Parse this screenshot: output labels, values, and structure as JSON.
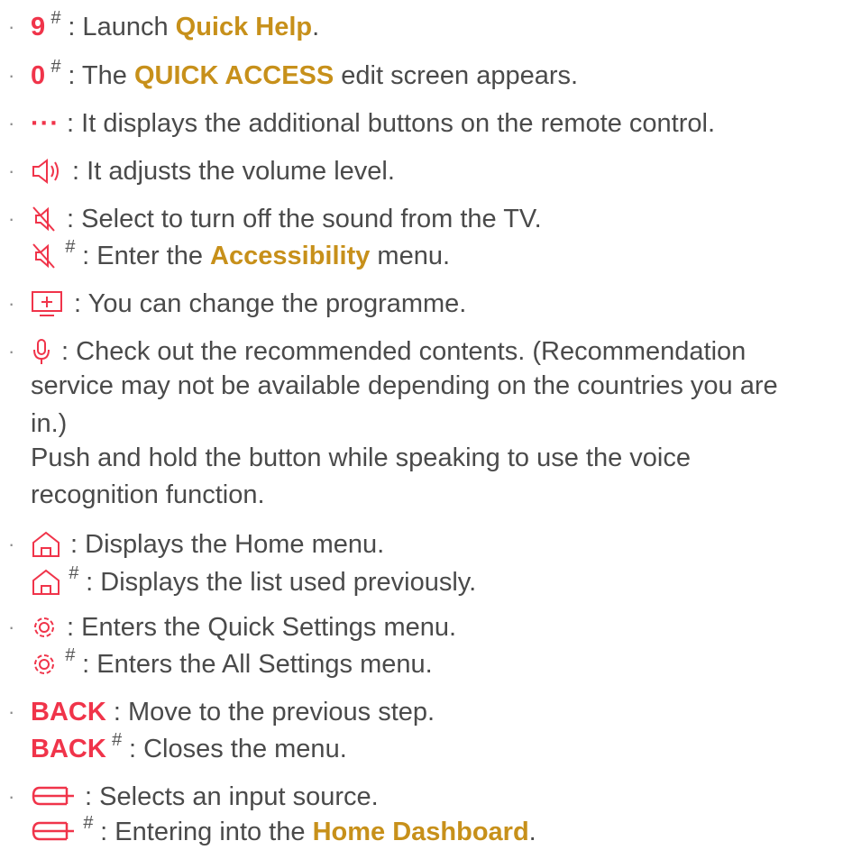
{
  "items": [
    {
      "key": "9",
      "text_pre": " : Launch ",
      "emph": "Quick Help",
      "text_post": "."
    },
    {
      "key": "0",
      "text_pre": " : The ",
      "emph": "QUICK ACCESS",
      "text_post": " edit screen appears."
    },
    {
      "key": "···",
      "text": " : It displays the additional buttons on the remote control."
    },
    {
      "text": " : It adjusts the volume level.",
      "icon": "volume-icon"
    },
    {
      "text": " : Select to turn off the sound from the TV.",
      "icon": "mute-icon"
    },
    {
      "text_pre": " : Enter the ",
      "emph": "Accessibility",
      "text_post": " menu.",
      "icon": "mute-icon"
    },
    {
      "text": " : You can change the programme.",
      "icon": "channel-icon"
    },
    {
      "text_lines": [
        " : Check out the recommended contents. (Recommendation",
        "service may not be available depending on the countries you are",
        "in.)",
        "Push and hold the button while speaking to use the voice",
        "recognition function."
      ],
      "icon": "microphone-icon"
    },
    {
      "text": " : Displays the Home menu.",
      "icon": "home-icon"
    },
    {
      "text": " : Displays the list used previously.",
      "icon": "home-icon"
    },
    {
      "text": " : Enters the Quick Settings menu.",
      "icon": "settings-icon"
    },
    {
      "text": " : Enters the All Settings menu.",
      "icon": "settings-icon"
    },
    {
      "key": "BACK",
      "text": " : Move to the previous step."
    },
    {
      "key": "BACK",
      "text": " : Closes the menu."
    },
    {
      "text": " : Selects an input source.",
      "icon": "input-icon"
    },
    {
      "text_pre": " : Entering into the ",
      "emph": "Home Dashboard",
      "text_post": ".",
      "icon": "input-icon"
    }
  ],
  "bullet": "·",
  "hash": "#",
  "colors": {
    "accent_red": "#f0344a",
    "accent_gold": "#c7901a",
    "text": "#4a4a4a"
  }
}
